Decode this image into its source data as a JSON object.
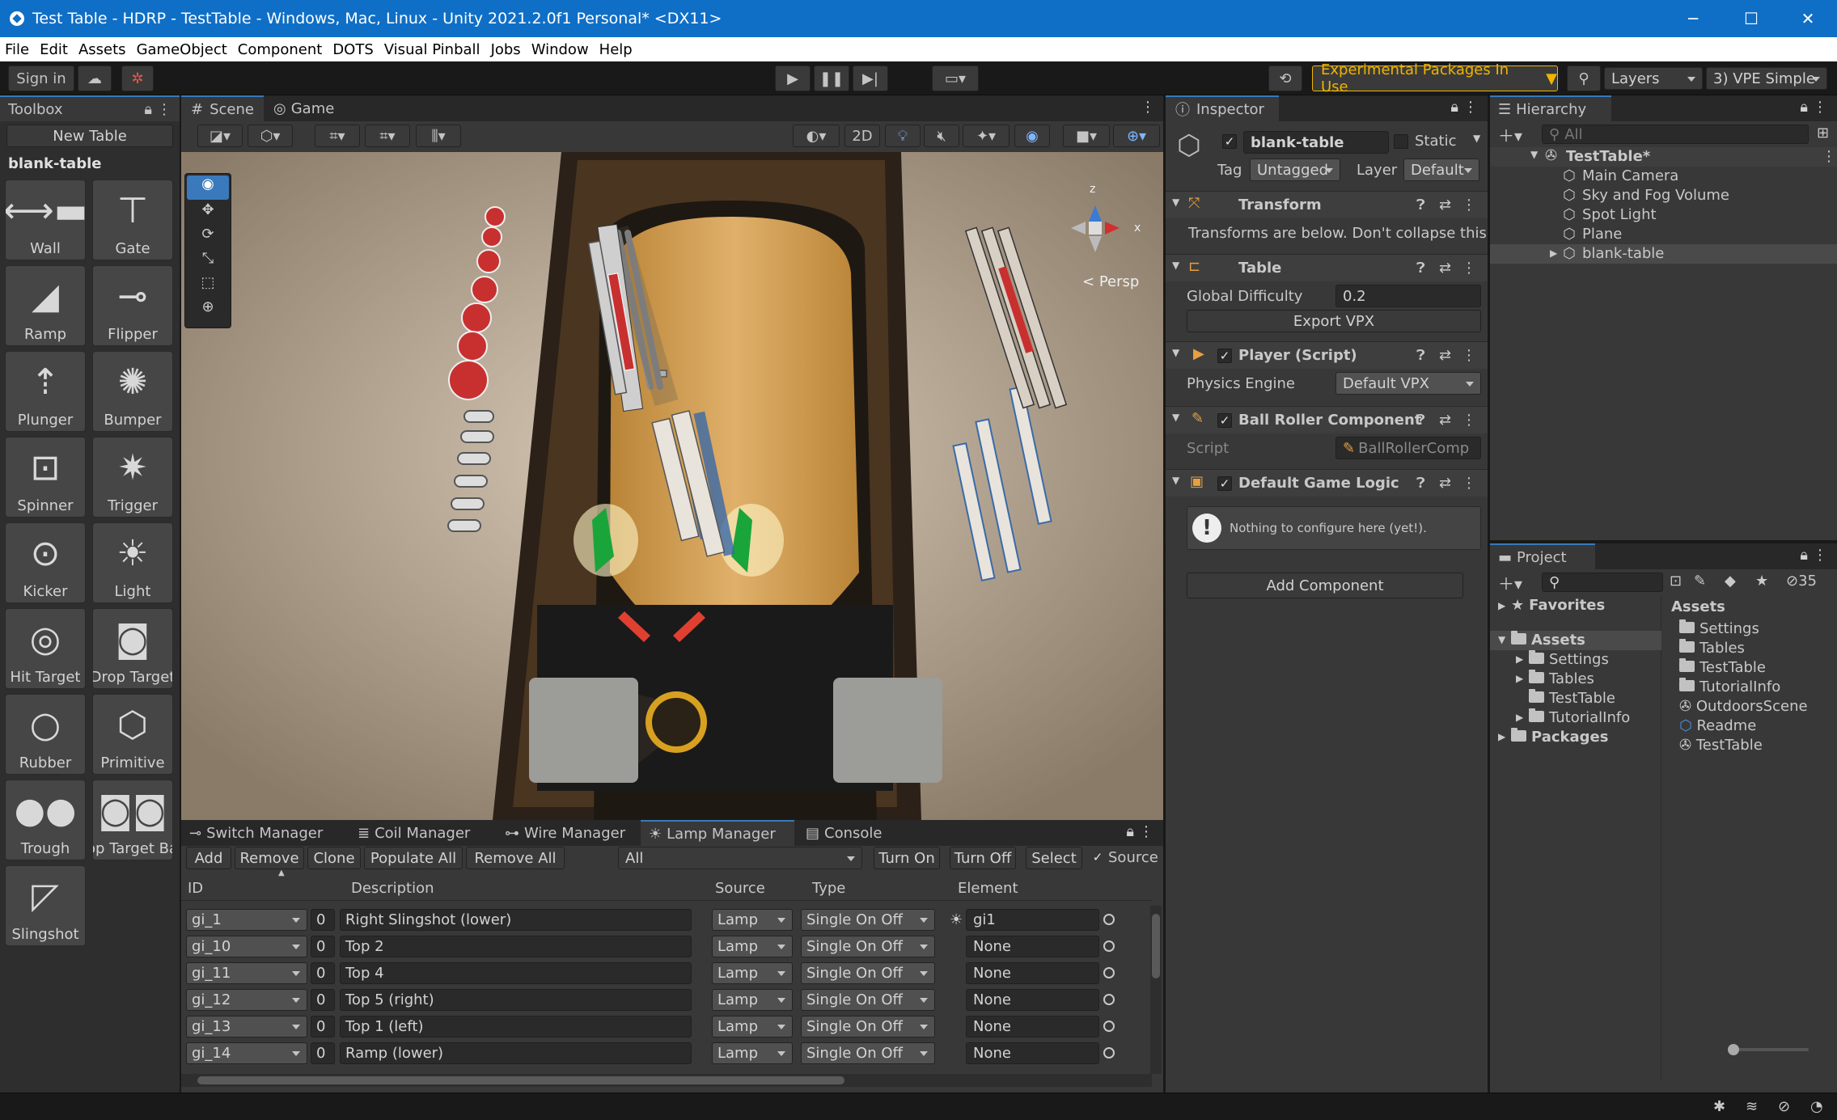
{
  "window": {
    "title": "Test Table - HDRP - TestTable - Windows, Mac, Linux - Unity 2021.2.0f1 Personal* <DX11>",
    "minimize": "─",
    "maximize": "☐",
    "close": "✕"
  },
  "menu": [
    "File",
    "Edit",
    "Assets",
    "GameObject",
    "Component",
    "DOTS",
    "Visual Pinball",
    "Jobs",
    "Window",
    "Help"
  ],
  "toolbar": {
    "sign_in": "Sign in",
    "experimental": "Experimental Packages In Use",
    "layers": "Layers",
    "layout": "3) VPE Simple"
  },
  "toolbox": {
    "tab": "Toolbox",
    "new_table": "New Table",
    "table_name": "blank-table",
    "tools": [
      {
        "label": "Wall",
        "icon": "wall-icon"
      },
      {
        "label": "Gate",
        "icon": "gate-icon"
      },
      {
        "label": "Ramp",
        "icon": "ramp-icon"
      },
      {
        "label": "Flipper",
        "icon": "flipper-icon"
      },
      {
        "label": "Plunger",
        "icon": "plunger-icon"
      },
      {
        "label": "Bumper",
        "icon": "bumper-icon"
      },
      {
        "label": "Spinner",
        "icon": "spinner-icon"
      },
      {
        "label": "Trigger",
        "icon": "trigger-icon"
      },
      {
        "label": "Kicker",
        "icon": "kicker-icon"
      },
      {
        "label": "Light",
        "icon": "light-icon"
      },
      {
        "label": "Hit Target",
        "icon": "hit-target-icon"
      },
      {
        "label": "Drop Target",
        "icon": "drop-target-icon"
      },
      {
        "label": "Rubber",
        "icon": "rubber-icon"
      },
      {
        "label": "Primitive",
        "icon": "primitive-icon"
      },
      {
        "label": "Trough",
        "icon": "trough-icon"
      },
      {
        "label": "Drop Target Bank",
        "icon": "drop-target-bank-icon"
      },
      {
        "label": "Slingshot",
        "icon": "slingshot-icon"
      }
    ]
  },
  "scene": {
    "tab_scene": "Scene",
    "tab_game": "Game",
    "btn_2d": "2D",
    "persp": "Persp",
    "gizmo_z": "z",
    "gizmo_x": "x"
  },
  "inspector": {
    "tab": "Inspector",
    "object_name": "blank-table",
    "static": "Static",
    "tag_label": "Tag",
    "tag": "Untagged",
    "layer_label": "Layer",
    "layer": "Default",
    "transform": "Transform",
    "transform_note": "Transforms are below. Don't collapse this",
    "table": "Table",
    "global_difficulty_label": "Global Difficulty",
    "global_difficulty": "0.2",
    "export_vpx": "Export VPX",
    "player": "Player (Script)",
    "physics_label": "Physics Engine",
    "physics": "Default VPX",
    "ball_roller": "Ball Roller Component",
    "script_label": "Script",
    "script": "BallRollerComp",
    "game_logic": "Default Game Logic",
    "game_logic_note": "Nothing to configure here (yet!).",
    "add_component": "Add Component"
  },
  "hierarchy": {
    "tab": "Hierarchy",
    "search_placeholder": "All",
    "root": "TestTable*",
    "items": [
      "Main Camera",
      "Sky and Fog Volume",
      "Spot Light",
      "Plane",
      "blank-table"
    ]
  },
  "project": {
    "tab": "Project",
    "hidden_count": "35",
    "favorites": "Favorites",
    "assets_header": "Assets",
    "tree": [
      "Assets",
      "Settings",
      "Tables",
      "TestTable",
      "TutorialInfo",
      "Packages"
    ],
    "files": [
      "Settings",
      "Tables",
      "TestTable",
      "TutorialInfo",
      "OutdoorsScene",
      "Readme",
      "TestTable"
    ]
  },
  "bottom": {
    "tabs": [
      "Switch Manager",
      "Coil Manager",
      "Wire Manager",
      "Lamp Manager",
      "Console"
    ],
    "buttons": [
      "Add",
      "Remove",
      "Clone",
      "Populate All",
      "Remove All"
    ],
    "filter": "All",
    "turn_on": "Turn On",
    "turn_off": "Turn Off",
    "select": "Select",
    "source_toggle": "Source",
    "columns": [
      "ID",
      "Description",
      "Source",
      "Type",
      "Element"
    ],
    "rows": [
      {
        "id": "gi_1",
        "num": "0",
        "desc": "Right Slingshot (lower)",
        "source": "Lamp",
        "type": "Single On Off",
        "element": "gi1"
      },
      {
        "id": "gi_10",
        "num": "0",
        "desc": "Top 2",
        "source": "Lamp",
        "type": "Single On Off",
        "element": "None"
      },
      {
        "id": "gi_11",
        "num": "0",
        "desc": "Top 4",
        "source": "Lamp",
        "type": "Single On Off",
        "element": "None"
      },
      {
        "id": "gi_12",
        "num": "0",
        "desc": "Top 5 (right)",
        "source": "Lamp",
        "type": "Single On Off",
        "element": "None"
      },
      {
        "id": "gi_13",
        "num": "0",
        "desc": "Top 1 (left)",
        "source": "Lamp",
        "type": "Single On Off",
        "element": "None"
      },
      {
        "id": "gi_14",
        "num": "0",
        "desc": "Ramp (lower)",
        "source": "Lamp",
        "type": "Single On Off",
        "element": "None"
      }
    ]
  },
  "colors": {
    "accent": "#3a79bb",
    "titlebar": "#0f6fc6",
    "warning": "#f0b400",
    "panel": "#383838"
  }
}
